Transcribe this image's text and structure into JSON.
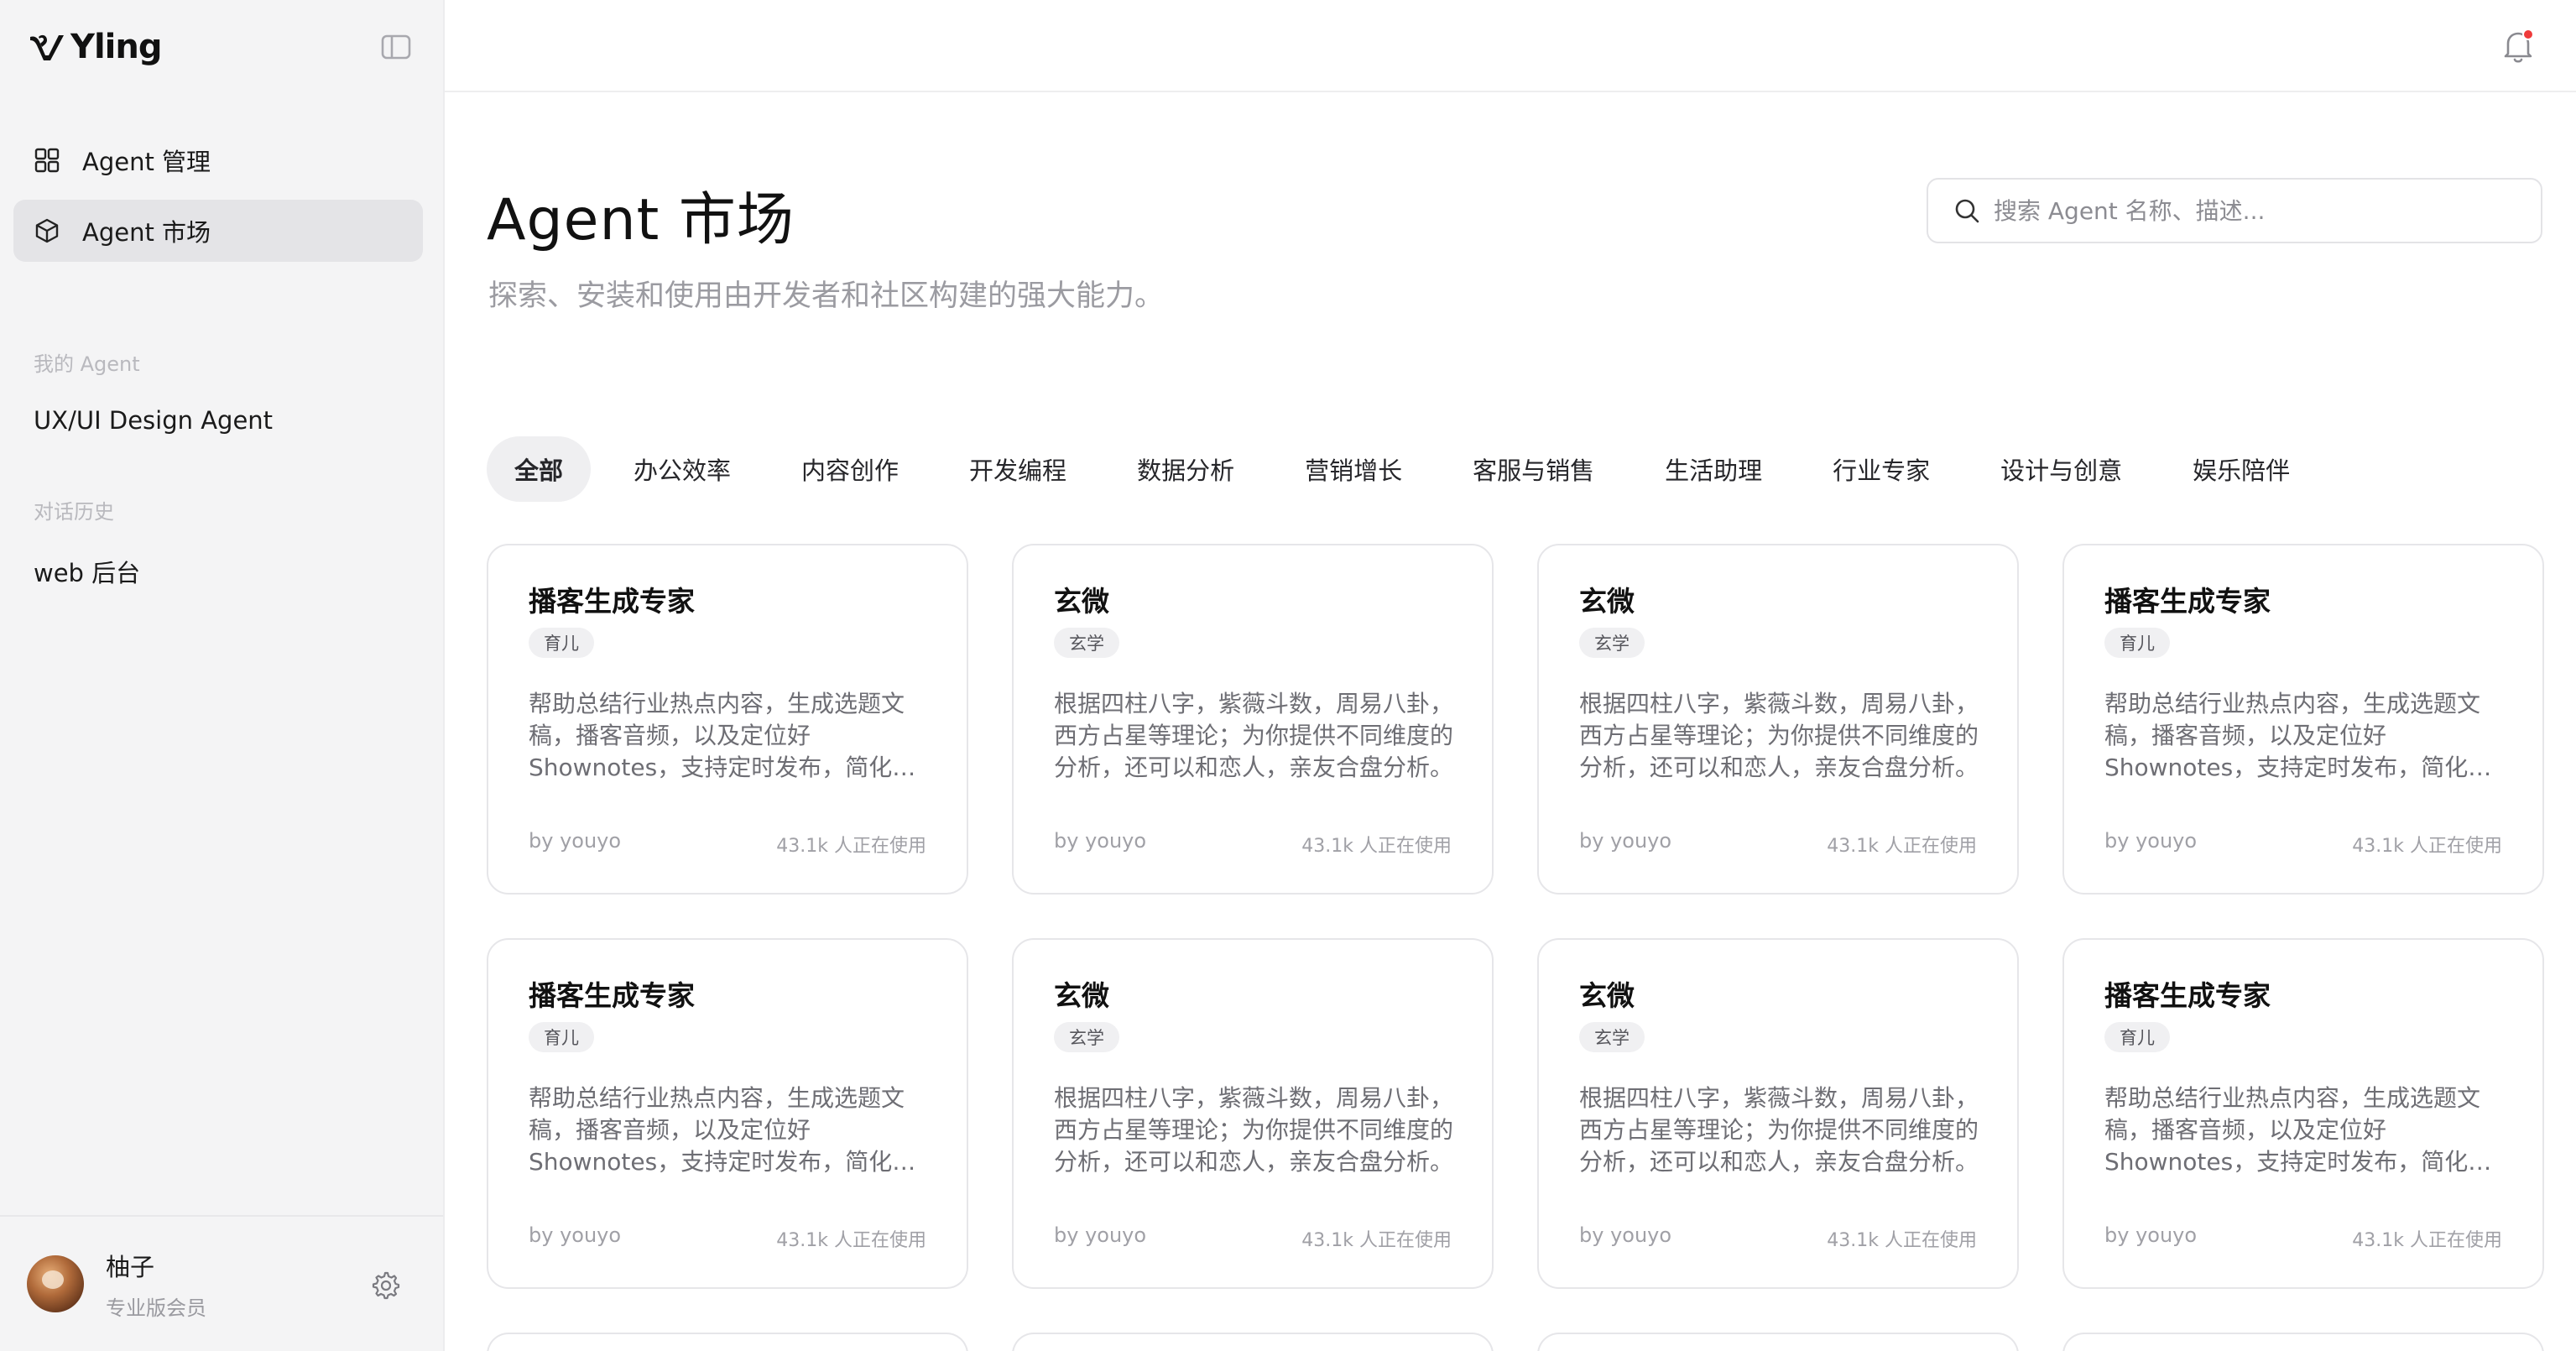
{
  "brand": {
    "name": "Yling"
  },
  "sidebar": {
    "nav": [
      {
        "label": "Agent 管理",
        "icon": "grid-icon"
      },
      {
        "label": "Agent 市场",
        "icon": "cube-icon",
        "active": true
      }
    ],
    "my_agents_label": "我的 Agent",
    "my_agents": [
      "UX/UI Design Agent"
    ],
    "history_label": "对话历史",
    "history": [
      "web 后台"
    ]
  },
  "user": {
    "name": "柚子",
    "plan": "专业版会员"
  },
  "page": {
    "title": "Agent 市场",
    "subtitle": "探索、安装和使用由开发者和社区构建的强大能力。"
  },
  "search": {
    "placeholder": "搜索 Agent 名称、描述..."
  },
  "tabs": [
    "全部",
    "办公效率",
    "内容创作",
    "开发编程",
    "数据分析",
    "营销增长",
    "客服与销售",
    "生活助理",
    "行业专家",
    "设计与创意",
    "娱乐陪伴"
  ],
  "cards": [
    {
      "title": "播客生成专家",
      "tag": "育儿",
      "desc": "帮助总结行业热点内容，生成选题文稿，播客音频，以及定位好Shownotes，支持定时发布，简化播客制作流程。",
      "author": "by youyo",
      "users": "43.1k 人正在使用"
    },
    {
      "title": "玄微",
      "tag": "玄学",
      "desc": "根据四柱八字，紫薇斗数，周易八卦，西方占星等理论；为你提供不同维度的分析，还可以和恋人，亲友合盘分析。",
      "author": "by youyo",
      "users": "43.1k 人正在使用"
    },
    {
      "title": "玄微",
      "tag": "玄学",
      "desc": "根据四柱八字，紫薇斗数，周易八卦，西方占星等理论；为你提供不同维度的分析，还可以和恋人，亲友合盘分析。",
      "author": "by youyo",
      "users": "43.1k 人正在使用"
    },
    {
      "title": "播客生成专家",
      "tag": "育儿",
      "desc": "帮助总结行业热点内容，生成选题文稿，播客音频，以及定位好Shownotes，支持定时发布，简化播客制作流程。",
      "author": "by youyo",
      "users": "43.1k 人正在使用"
    },
    {
      "title": "播客生成专家",
      "tag": "育儿",
      "desc": "帮助总结行业热点内容，生成选题文稿，播客音频，以及定位好Shownotes，支持定时发布，简化播客制作流程。",
      "author": "by youyo",
      "users": "43.1k 人正在使用"
    },
    {
      "title": "玄微",
      "tag": "玄学",
      "desc": "根据四柱八字，紫薇斗数，周易八卦，西方占星等理论；为你提供不同维度的分析，还可以和恋人，亲友合盘分析。",
      "author": "by youyo",
      "users": "43.1k 人正在使用"
    },
    {
      "title": "玄微",
      "tag": "玄学",
      "desc": "根据四柱八字，紫薇斗数，周易八卦，西方占星等理论；为你提供不同维度的分析，还可以和恋人，亲友合盘分析。",
      "author": "by youyo",
      "users": "43.1k 人正在使用"
    },
    {
      "title": "播客生成专家",
      "tag": "育儿",
      "desc": "帮助总结行业热点内容，生成选题文稿，播客音频，以及定位好Shownotes，支持定时发布，简化播客制作流程。",
      "author": "by youyo",
      "users": "43.1k 人正在使用"
    }
  ],
  "colors": {
    "accent_dot": "#ef3b3b",
    "active_bg": "#e4e4e7"
  }
}
